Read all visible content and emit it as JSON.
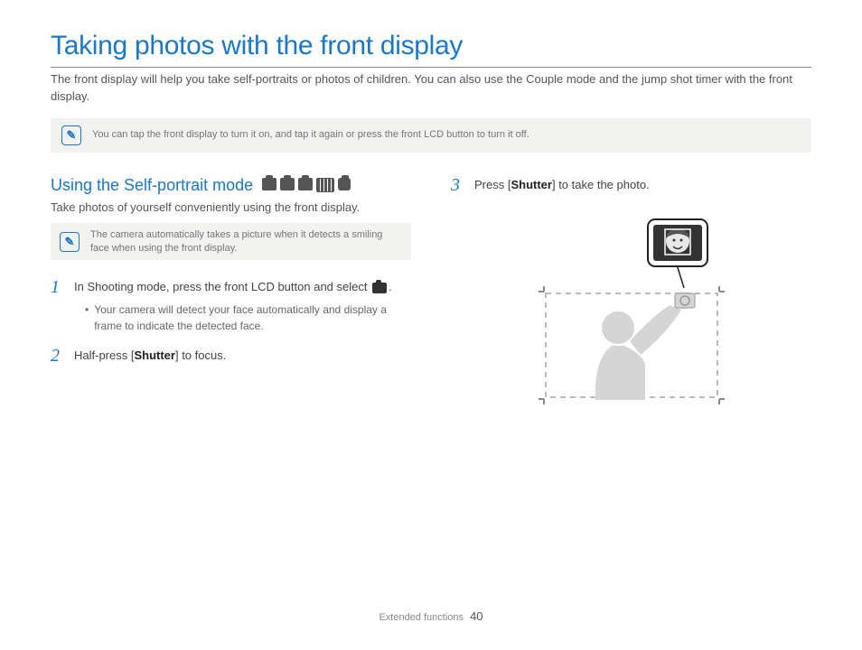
{
  "title": "Taking photos with the front display",
  "intro": "The front display will help you take self-portraits or photos of children. You can also use the Couple mode and the jump shot timer with the front display.",
  "top_note": "You can tap the front display to turn it on, and tap it again or press the front LCD button to turn it off.",
  "section": {
    "heading": "Using the Self-portrait mode",
    "desc": "Take photos of yourself conveniently using the front display.",
    "note": "The camera automatically takes a picture when it detects a smiling face when using the front display."
  },
  "steps": {
    "s1": {
      "num": "1",
      "text_a": "In Shooting mode, press the front LCD button and select ",
      "text_b": ".",
      "bullet": "Your camera will detect your face automatically and display a frame to indicate the detected face."
    },
    "s2": {
      "num": "2",
      "text_a": "Half-press [",
      "bold": "Shutter",
      "text_b": "] to focus."
    },
    "s3": {
      "num": "3",
      "text_a": "Press [",
      "bold": "Shutter",
      "text_b": "] to take the photo."
    }
  },
  "footer": {
    "section": "Extended functions",
    "page": "40"
  }
}
